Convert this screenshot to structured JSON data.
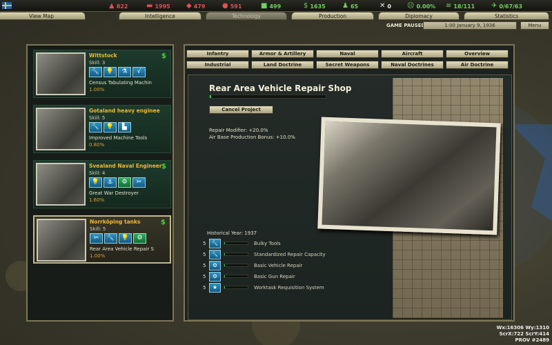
{
  "resources": [
    {
      "icon": "energy-icon",
      "glyph": "▲",
      "value": "822",
      "color": "#e05050"
    },
    {
      "icon": "metal-icon",
      "glyph": "▬",
      "value": "1995",
      "color": "#e05050"
    },
    {
      "icon": "rare-materials-icon",
      "glyph": "◆",
      "value": "479",
      "color": "#e05050"
    },
    {
      "icon": "oil-icon",
      "glyph": "●",
      "value": "591",
      "color": "#e05050"
    },
    {
      "icon": "supplies-icon",
      "glyph": "■",
      "value": "499",
      "color": "#6ed35a"
    },
    {
      "icon": "money-icon",
      "glyph": "$",
      "value": "1635",
      "color": "#6ed35a"
    },
    {
      "icon": "manpower-icon",
      "glyph": "♟",
      "value": "65",
      "color": "#6ed35a"
    },
    {
      "icon": "transports-icon",
      "glyph": "✕",
      "value": "0",
      "color": "#e8e8e8"
    },
    {
      "icon": "dissent-icon",
      "glyph": "☹",
      "value": "0.00%",
      "color": "#6ed35a"
    },
    {
      "icon": "convoys-icon",
      "glyph": "≡",
      "value": "18/111",
      "color": "#6ed35a"
    },
    {
      "icon": "escorts-icon",
      "glyph": "✈",
      "value": "0/67/63",
      "color": "#6ed35a"
    }
  ],
  "tabs": [
    "View Map",
    "Intelligence",
    "Technology",
    "Production",
    "Diplomacy",
    "Statistics"
  ],
  "status": {
    "paused": "GAME PAUSED",
    "date": "1:00 January 9, 1936",
    "menu": "Menu"
  },
  "teams": [
    {
      "name": "Wittstock",
      "skill": "Skill: 3",
      "icons": [
        "wrench-icon",
        "lightbulb-icon",
        "flask-icon",
        "sqrt-icon"
      ],
      "glyphs": [
        "🔧",
        "💡",
        "⚗",
        "√"
      ],
      "project": "Census Tabulating Machin",
      "progress": "1.00%"
    },
    {
      "name": "Gotaland heavy enginee",
      "skill": "Skill: 5",
      "icons": [
        "wrench-icon",
        "lightbulb-icon",
        "factory-icon"
      ],
      "glyphs": [
        "🔧",
        "💡",
        "▙"
      ],
      "project": "Improved Machine Tools",
      "progress": "0.80%"
    },
    {
      "name": "Svealand Naval Engineer",
      "skill": "Skill: 4",
      "icons": [
        "lightbulb-icon",
        "anchor-icon",
        "gears-icon",
        "tools-icon"
      ],
      "glyphs": [
        "💡",
        "⚓",
        "⚙",
        "✂"
      ],
      "project": "Great War Destroyer",
      "progress": "1.60%"
    },
    {
      "name": "Norrköping tanks",
      "skill": "Skill: 5",
      "icons": [
        "tools-icon",
        "wrench-icon",
        "lightbulb-icon",
        "gears-icon"
      ],
      "glyphs": [
        "✂",
        "🔧",
        "💡",
        "⚙"
      ],
      "project": "Rear Area Vehicle Repair S",
      "progress": "1.00%"
    }
  ],
  "categories_row1": [
    "Infantry",
    "Armor & Artillery",
    "Naval",
    "Aircraft",
    "Overview"
  ],
  "categories_row2": [
    "Industrial",
    "Land Doctrine",
    "Secret Weapons",
    "Naval Doctrines",
    "Air Doctrine"
  ],
  "project": {
    "title": "Rear Area Vehicle Repair Shop",
    "progress": 0.01,
    "cancel_label": "Cancel Project",
    "modifiers": [
      "Repair Modifier: +20.0%",
      "Air Base Production Bonus: +10.0%"
    ],
    "historical_year": "Historical Year: 1937",
    "components": [
      {
        "level": "5",
        "icon": "wrench-icon",
        "glyph": "🔧",
        "name": "Bulky Tools"
      },
      {
        "level": "5",
        "icon": "wrench-icon",
        "glyph": "🔧",
        "name": "Standardized Repair Capacity"
      },
      {
        "level": "5",
        "icon": "gears-icon",
        "glyph": "⚙",
        "name": "Basic Vehicle Repair"
      },
      {
        "level": "5",
        "icon": "gears-icon",
        "glyph": "⚙",
        "name": "Basic Gun Repair"
      },
      {
        "level": "5",
        "icon": "star-icon",
        "glyph": "★",
        "name": "Worktask Requisition System"
      }
    ]
  },
  "debug": {
    "line1": "Wx:16306 Wy:1310",
    "line2": "ScrX:722 ScrY:414",
    "line3": "PROV #2489"
  }
}
